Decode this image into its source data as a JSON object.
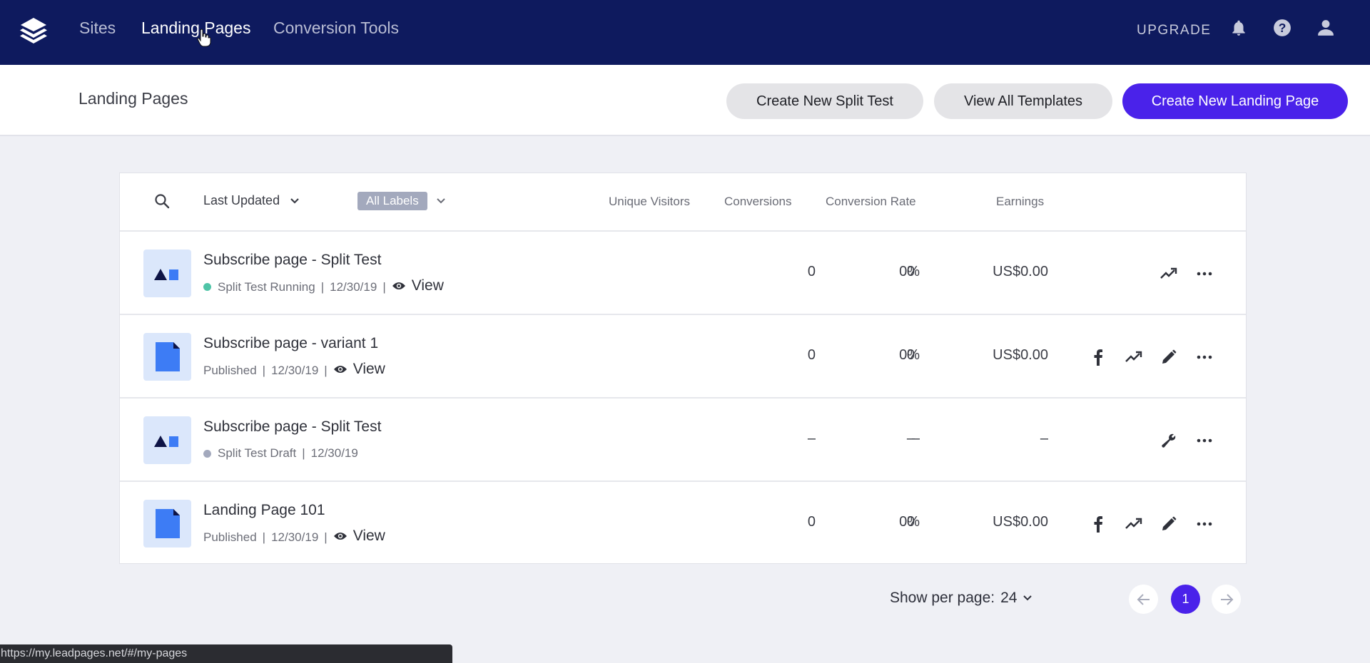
{
  "topnav": {
    "logo": "layers-logo-icon",
    "links": [
      {
        "label": "Sites",
        "active": false
      },
      {
        "label": "Landing Pages",
        "active": true
      },
      {
        "label": "Conversion Tools",
        "active": false
      }
    ],
    "upgrade_label": "UPGRADE",
    "icons": [
      "bell-icon",
      "help-icon",
      "user-icon"
    ]
  },
  "subheader": {
    "title": "Landing Pages",
    "buttons": {
      "split_test": "Create New Split Test",
      "templates": "View All Templates",
      "create": "Create New Landing Page"
    }
  },
  "colors": {
    "nav_bg": "#0e1a5e",
    "accent": "#4a22ea",
    "running_dot": "#4fc4a7",
    "draft_dot": "#a3a9bd",
    "page_blue": "#3d7cf5"
  },
  "table": {
    "sort_label": "Last Updated",
    "labels_filter": "All Labels",
    "columns": [
      "Unique Visitors",
      "Conversions",
      "Conversion Rate",
      "Earnings"
    ],
    "rows": [
      {
        "title": "Subscribe page - Split Test",
        "type": "split-test",
        "status": "Split Test Running",
        "status_dot": "running",
        "date": "12/30/19",
        "view_label": "View",
        "unique_visitors": "0",
        "conversions": "0",
        "conversion_rate": "0%",
        "earnings": "US$0.00",
        "actions": [
          "trending-up-icon",
          "more-icon"
        ]
      },
      {
        "title": "Subscribe page - variant 1",
        "type": "page",
        "status": "Published",
        "status_dot": null,
        "date": "12/30/19",
        "view_label": "View",
        "unique_visitors": "0",
        "conversions": "0",
        "conversion_rate": "0%",
        "earnings": "US$0.00",
        "actions": [
          "facebook-icon",
          "trending-up-icon",
          "pencil-icon",
          "more-icon"
        ]
      },
      {
        "title": "Subscribe page - Split Test",
        "type": "split-test",
        "status": "Split Test Draft",
        "status_dot": "draft",
        "date": "12/30/19",
        "view_label": null,
        "unique_visitors": "–",
        "conversions": "–",
        "conversion_rate": "–",
        "earnings": "–",
        "actions": [
          "wrench-icon",
          "more-icon"
        ]
      },
      {
        "title": "Landing Page 101",
        "type": "page",
        "status": "Published",
        "status_dot": null,
        "date": "12/30/19",
        "view_label": "View",
        "unique_visitors": "0",
        "conversions": "0",
        "conversion_rate": "0%",
        "earnings": "US$0.00",
        "actions": [
          "facebook-icon",
          "trending-up-icon",
          "pencil-icon",
          "more-icon"
        ]
      }
    ]
  },
  "pagination": {
    "per_page_label": "Show per page:",
    "per_page_value": "24",
    "current_page": "1"
  },
  "statusbar": {
    "url": "https://my.leadpages.net/#/my-pages"
  }
}
